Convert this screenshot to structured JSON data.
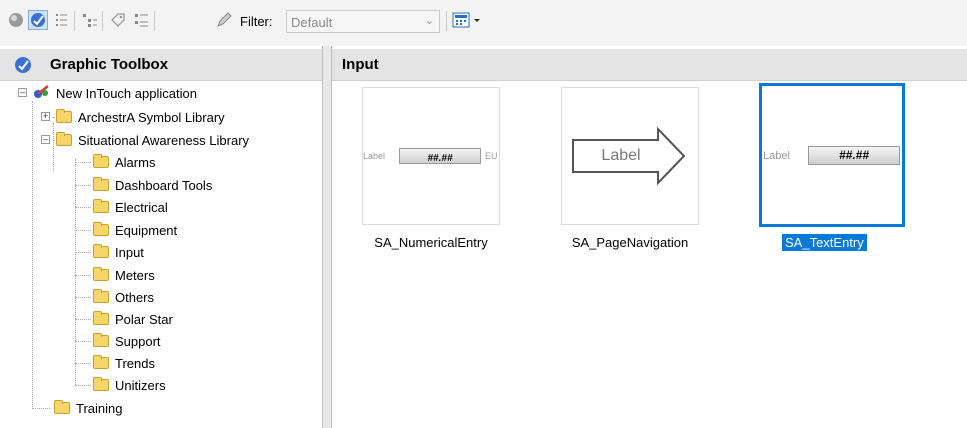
{
  "toolbar": {
    "filter_label": "Filter:",
    "filter_value": "Default"
  },
  "left_pane": {
    "title": "Graphic Toolbox"
  },
  "tree": {
    "root": "New InTouch application",
    "archestra": "ArchestrA Symbol Library",
    "sa_library": "Situational Awareness Library",
    "children": [
      "Alarms",
      "Dashboard Tools",
      "Electrical",
      "Equipment",
      "Input",
      "Meters",
      "Others",
      "Polar Star",
      "Support",
      "Trends",
      "Unitizers"
    ],
    "training": "Training"
  },
  "right_pane": {
    "title": "Input"
  },
  "symbols": [
    {
      "caption": "SA_NumericalEntry",
      "label": "Label",
      "value": "##.##",
      "unit": "EU"
    },
    {
      "caption": "SA_PageNavigation",
      "label": "Label"
    },
    {
      "caption": "SA_TextEntry",
      "label": "Label",
      "value": "##.##"
    }
  ],
  "colors": {
    "selection": "#0a78d7"
  }
}
